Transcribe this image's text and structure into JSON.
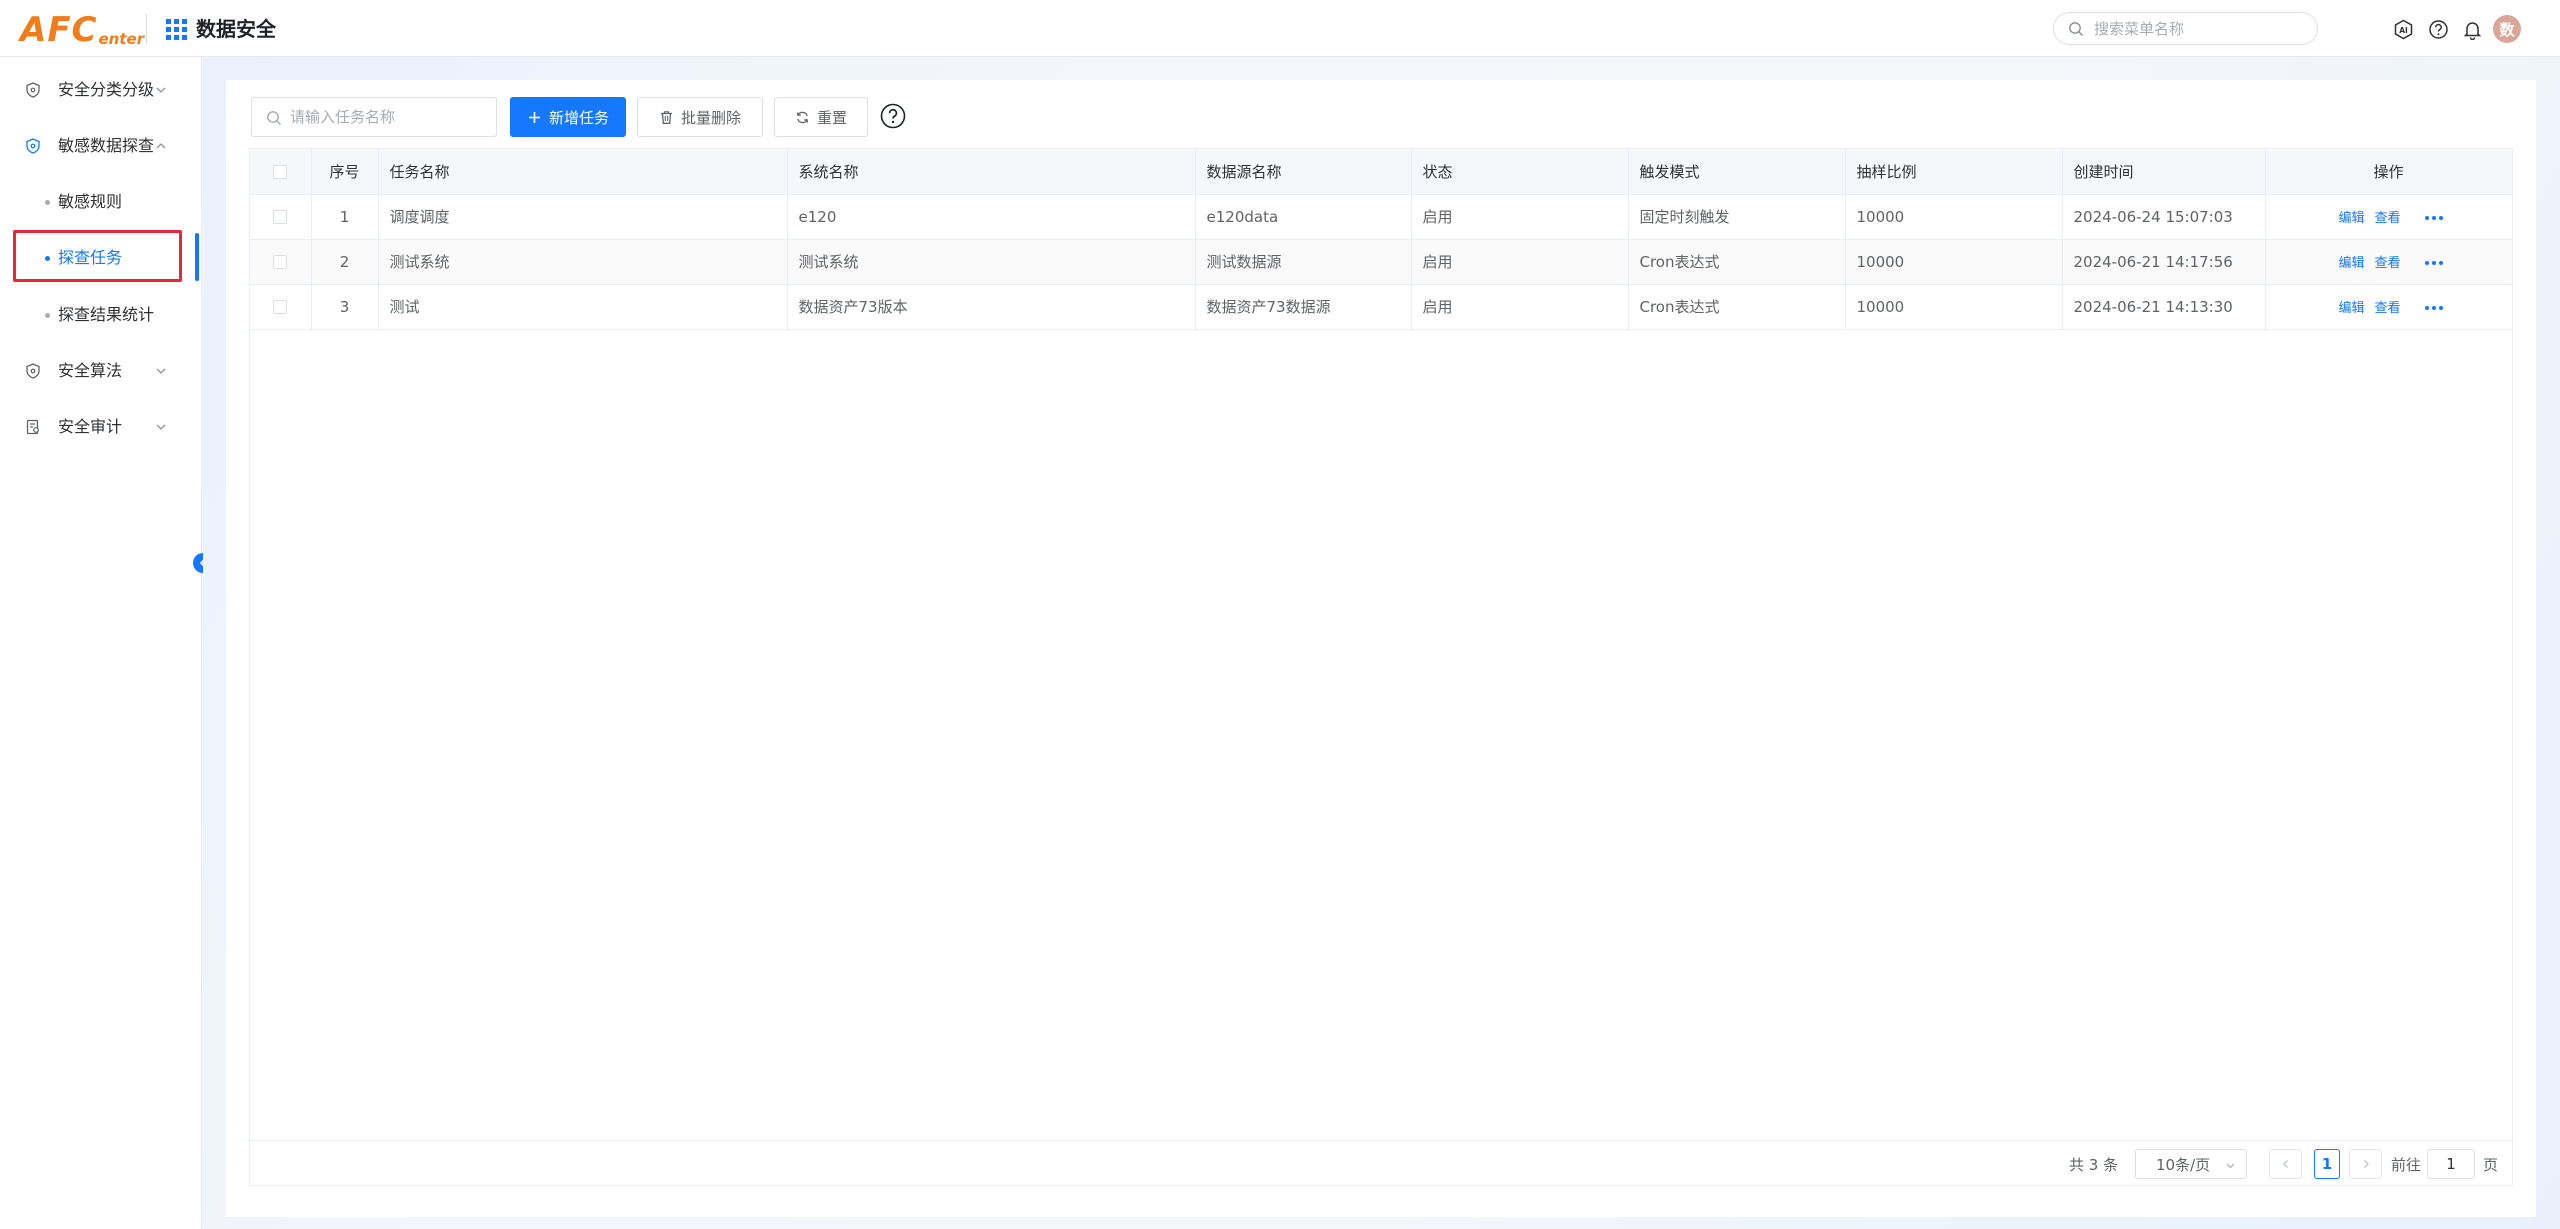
{
  "header": {
    "logo_main": "AFC",
    "logo_sub": "enter",
    "title": "数据安全",
    "search_placeholder": "搜索菜单名称",
    "avatar_text": "数"
  },
  "sidebar": {
    "items": [
      {
        "label": "安全分类分级",
        "icon": "shield-icon",
        "expanded": false
      },
      {
        "label": "敏感数据探查",
        "icon": "shield-icon",
        "expanded": true
      },
      {
        "label": "敏感规则"
      },
      {
        "label": "探查任务",
        "active": true
      },
      {
        "label": "探查结果统计"
      },
      {
        "label": "安全算法",
        "icon": "shield-icon",
        "expanded": false
      },
      {
        "label": "安全审计",
        "icon": "audit-icon",
        "expanded": false
      }
    ]
  },
  "toolbar": {
    "search_placeholder": "请输入任务名称",
    "add_label": "新增任务",
    "batch_delete_label": "批量删除",
    "reset_label": "重置"
  },
  "table": {
    "columns": [
      "序号",
      "任务名称",
      "系统名称",
      "数据源名称",
      "状态",
      "触发模式",
      "抽样比例",
      "创建时间",
      "操作"
    ],
    "rows": [
      {
        "index": "1",
        "task": "调度调度",
        "system": "e120",
        "datasource": "e120data",
        "status": "启用",
        "trigger": "固定时刻触发",
        "sample": "10000",
        "created": "2024-06-24 15:07:03"
      },
      {
        "index": "2",
        "task": "测试系统",
        "system": "测试系统",
        "datasource": "测试数据源",
        "status": "启用",
        "trigger": "Cron表达式",
        "sample": "10000",
        "created": "2024-06-21 14:17:56"
      },
      {
        "index": "3",
        "task": "测试",
        "system": "数据资产73版本",
        "datasource": "数据资产73数据源",
        "status": "启用",
        "trigger": "Cron表达式",
        "sample": "10000",
        "created": "2024-06-21 14:13:30"
      }
    ],
    "action_edit": "编辑",
    "action_view": "查看"
  },
  "pagination": {
    "total_text": "共 3 条",
    "page_size": "10条/页",
    "current_page": "1",
    "goto_label": "前往",
    "goto_value": "1",
    "page_suffix": "页"
  },
  "colors": {
    "primary": "#1677ff",
    "logo": "#f07d1a",
    "highlight": "#e5263b"
  }
}
